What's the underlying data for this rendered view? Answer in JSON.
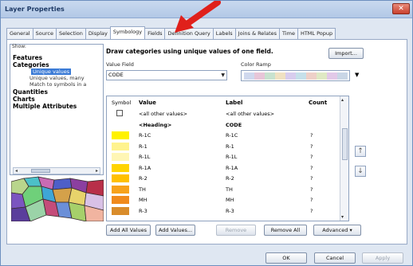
{
  "window": {
    "title": "Layer Properties",
    "close_glyph": "✕"
  },
  "tabs": [
    {
      "label": "General",
      "active": false
    },
    {
      "label": "Source",
      "active": false
    },
    {
      "label": "Selection",
      "active": false
    },
    {
      "label": "Display",
      "active": false
    },
    {
      "label": "Symbology",
      "active": true
    },
    {
      "label": "Fields",
      "active": false
    },
    {
      "label": "Definition Query",
      "active": false
    },
    {
      "label": "Labels",
      "active": false
    },
    {
      "label": "Joins & Relates",
      "active": false
    },
    {
      "label": "Time",
      "active": false
    },
    {
      "label": "HTML Popup",
      "active": false
    }
  ],
  "show": {
    "label": "Show:",
    "items": [
      {
        "label": "Features",
        "type": "bold"
      },
      {
        "label": "Categories",
        "type": "bold"
      },
      {
        "label": "Unique values",
        "type": "sub-selected"
      },
      {
        "label": "Unique values, many",
        "type": "sub"
      },
      {
        "label": "Match to symbols in a",
        "type": "sub"
      },
      {
        "label": "Quantities",
        "type": "bold"
      },
      {
        "label": "Charts",
        "type": "bold"
      },
      {
        "label": "Multiple Attributes",
        "type": "bold"
      }
    ]
  },
  "heading": "Draw categories using unique values of one field.",
  "import_label": "Import...",
  "value_field": {
    "label": "Value Field",
    "value": "CODE"
  },
  "color_ramp": {
    "label": "Color Ramp",
    "colors": [
      "#cfd8ee",
      "#e7c6d8",
      "#c8e2cf",
      "#f0e1c2",
      "#d8cdee",
      "#c6e0ea",
      "#eed0c8",
      "#dfe9c4",
      "#e2c9e8",
      "#c9d6e6"
    ]
  },
  "table": {
    "headers": {
      "symbol": "Symbol",
      "value": "Value",
      "label": "Label",
      "count": "Count"
    },
    "rows": [
      {
        "swatch": "checkbox",
        "value": "<all other values>",
        "label": "<all other values>",
        "count": ""
      },
      {
        "swatch": "none",
        "value": "<Heading>",
        "label": "CODE",
        "count": "",
        "bold": true
      },
      {
        "swatch": "#fff200",
        "value": "R-1C",
        "label": "R-1C",
        "count": "?"
      },
      {
        "swatch": "#fff38e",
        "value": "R-1",
        "label": "R-1",
        "count": "?"
      },
      {
        "swatch": "#fff6b5",
        "value": "R-1L",
        "label": "R-1L",
        "count": "?"
      },
      {
        "swatch": "#ffd400",
        "value": "R-1A",
        "label": "R-1A",
        "count": "?"
      },
      {
        "swatch": "#ffc000",
        "value": "R-2",
        "label": "R-2",
        "count": "?"
      },
      {
        "swatch": "#f7a21b",
        "value": "TH",
        "label": "TH",
        "count": "?"
      },
      {
        "swatch": "#f08a1c",
        "value": "MH",
        "label": "MH",
        "count": "?"
      },
      {
        "swatch": "#d98c2b",
        "value": "R-3",
        "label": "R-3",
        "count": "?"
      }
    ]
  },
  "side_buttons": {
    "up": "↑",
    "down": "↓"
  },
  "actions": {
    "add_all": "Add All Values",
    "add_values": "Add Values...",
    "remove": "Remove",
    "remove_all": "Remove All",
    "advanced": "Advanced"
  },
  "footer": {
    "ok": "OK",
    "cancel": "Cancel",
    "apply": "Apply"
  },
  "accent": {
    "arrow": "#e0201b",
    "selection": "#3b7bd6"
  }
}
